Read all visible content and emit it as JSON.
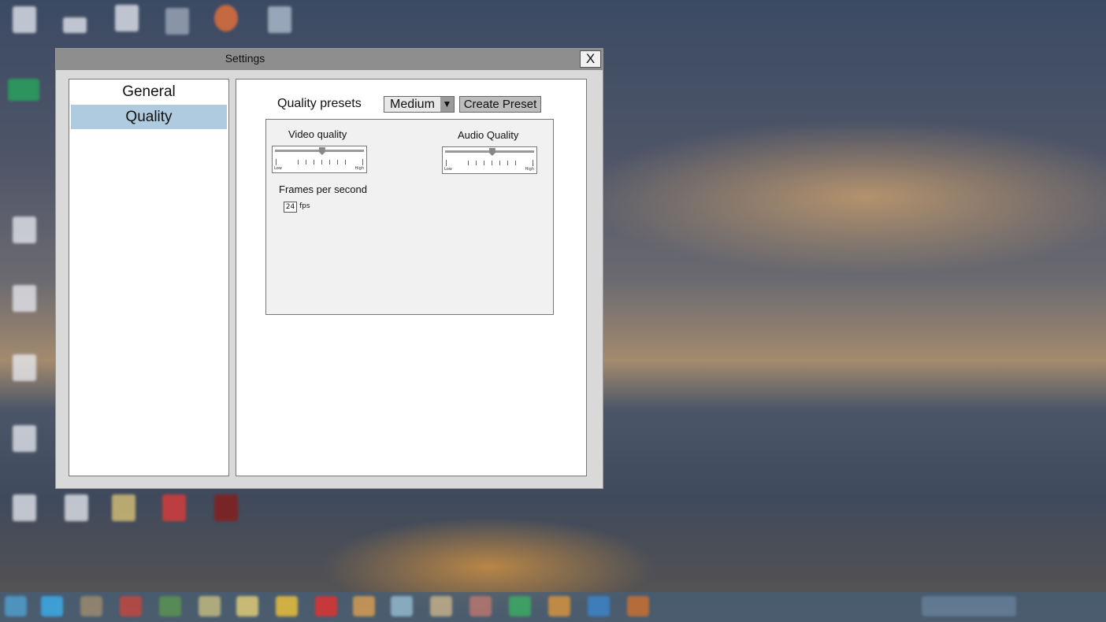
{
  "window": {
    "title": "Settings",
    "close_label": "X"
  },
  "sidebar": {
    "items": [
      {
        "label": "General",
        "active": false
      },
      {
        "label": "Quality",
        "active": true
      }
    ]
  },
  "quality": {
    "presets_label": "Quality presets",
    "preset_value": "Medium",
    "preset_arrow": "▼",
    "create_preset_label": "Create Preset",
    "video": {
      "label": "Video quality",
      "low_label": "Low",
      "high_label": "High",
      "level": 0.53
    },
    "audio": {
      "label": "Audio Quality",
      "low_label": "Low",
      "high_label": "High",
      "level": 0.53
    },
    "fps": {
      "label": "Frames per second",
      "value": "24",
      "unit": "fps"
    }
  },
  "colors": {
    "selected_item": "#aecbe0",
    "titlebar": "#8e8e8e",
    "panel": "#f1f1f1"
  }
}
